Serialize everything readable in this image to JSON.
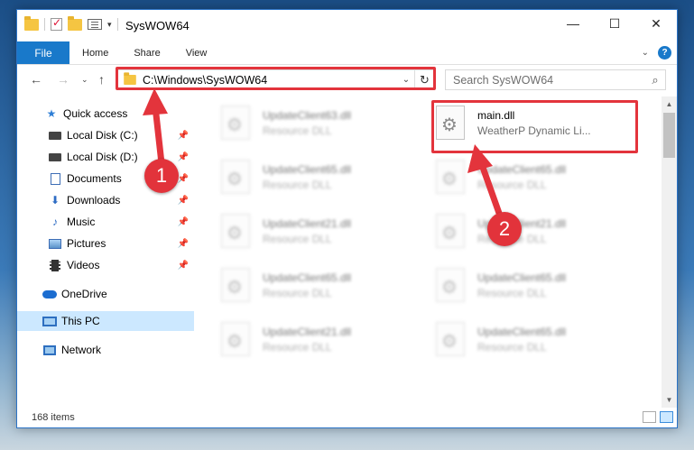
{
  "window": {
    "title": "SysWOW64",
    "qat_caret": "▾"
  },
  "ribbon": {
    "file_tab": "File",
    "tabs": [
      "Home",
      "Share",
      "View"
    ]
  },
  "address": {
    "path": "C:\\Windows\\SysWOW64"
  },
  "search": {
    "placeholder": "Search SysWOW64"
  },
  "sidebar": {
    "quick_access": "Quick access",
    "items": [
      "Local Disk (C:)",
      "Local Disk (D:)",
      "Documents",
      "Downloads",
      "Music",
      "Pictures",
      "Videos"
    ],
    "onedrive": "OneDrive",
    "this_pc": "This PC",
    "network": "Network"
  },
  "files": {
    "left": [
      {
        "name": "UpdateClient63.dll",
        "type": "Resource DLL"
      },
      {
        "name": "UpdateClient65.dll",
        "type": "Resource DLL"
      },
      {
        "name": "UpdateClient21.dll",
        "type": "Resource DLL"
      },
      {
        "name": "UpdateClient65.dll",
        "type": "Resource DLL"
      },
      {
        "name": "UpdateClient21.dll",
        "type": "Resource DLL"
      }
    ],
    "right": [
      {
        "name": "main.dll",
        "type": "WeatherP Dynamic Li..."
      },
      {
        "name": "UpdateClient65.dll",
        "type": "Resource DLL"
      },
      {
        "name": "UpdateClient21.dll",
        "type": "Resource DLL"
      },
      {
        "name": "UpdateClient65.dll",
        "type": "Resource DLL"
      },
      {
        "name": "UpdateClient65.dll",
        "type": "Resource DLL"
      }
    ]
  },
  "status": {
    "count": "168 items"
  },
  "annotations": {
    "step1": "1",
    "step2": "2",
    "color": "#e3343c"
  }
}
